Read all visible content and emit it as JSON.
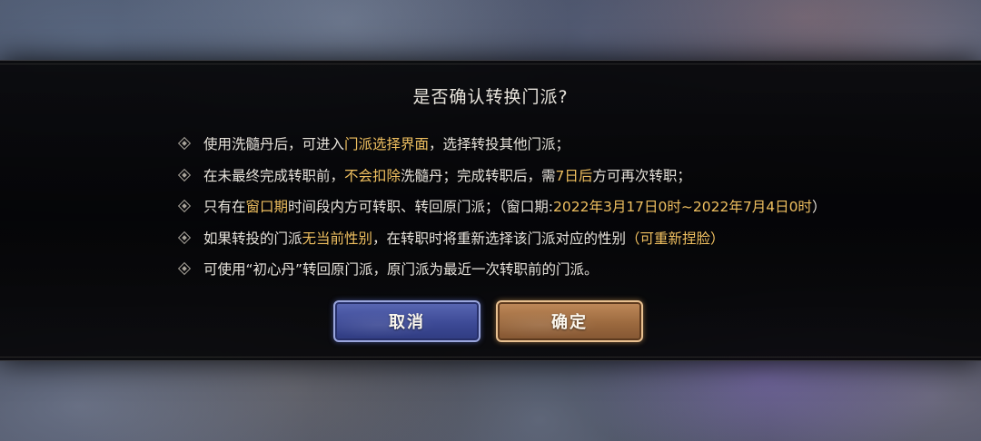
{
  "dialog": {
    "title": "是否确认转换门派?",
    "rules": [
      {
        "segments": [
          {
            "text": "使用洗髓丹后，可进入",
            "highlight": false
          },
          {
            "text": "门派选择界面",
            "highlight": true
          },
          {
            "text": "，选择转投其他门派；",
            "highlight": false
          }
        ]
      },
      {
        "segments": [
          {
            "text": "在未最终完成转职前，",
            "highlight": false
          },
          {
            "text": "不会扣除",
            "highlight": true
          },
          {
            "text": "洗髓丹；完成转职后，需",
            "highlight": false
          },
          {
            "text": "7日后",
            "highlight": true
          },
          {
            "text": "方可再次转职；",
            "highlight": false
          }
        ]
      },
      {
        "segments": [
          {
            "text": "只有在",
            "highlight": false
          },
          {
            "text": "窗口期",
            "highlight": true
          },
          {
            "text": "时间段内方可转职、转回原门派；（窗口期:",
            "highlight": false
          },
          {
            "text": "2022年3月17日0时~2022年7月4日0时",
            "highlight": true
          },
          {
            "text": "）",
            "highlight": false
          }
        ]
      },
      {
        "segments": [
          {
            "text": "如果转投的门派",
            "highlight": false
          },
          {
            "text": "无当前性别",
            "highlight": true
          },
          {
            "text": "，在转职时将重新选择该门派对应的性别",
            "highlight": false
          },
          {
            "text": "（可重新捏脸）",
            "highlight": true
          }
        ]
      },
      {
        "segments": [
          {
            "text": "可使用“初心丹”转回原门派，原门派为最近一次转职前的门派。",
            "highlight": false
          }
        ]
      }
    ],
    "buttons": {
      "cancel_label": "取消",
      "confirm_label": "确定"
    }
  },
  "colors": {
    "highlight": "#f0c060",
    "text": "#e6e2da",
    "cancel_button": "#3d4a96",
    "confirm_button": "#9c6a3f"
  },
  "icons": {
    "bullet": "diamond-bullet-icon"
  }
}
